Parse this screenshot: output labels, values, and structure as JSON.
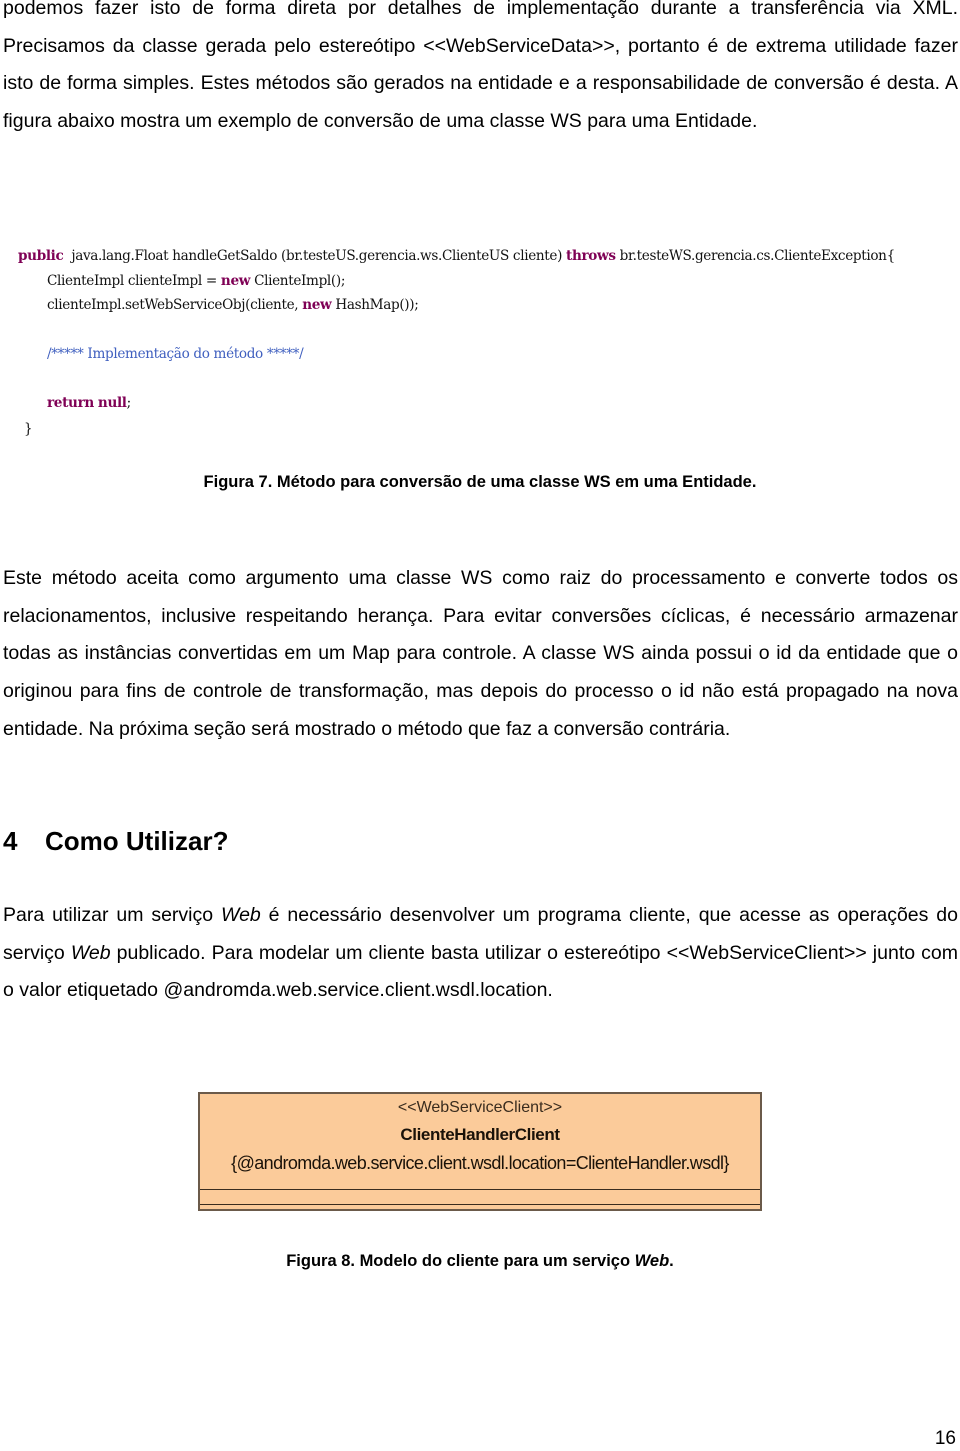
{
  "paragraphs": {
    "p1": "podemos fazer isto de forma direta por detalhes de implementação durante a transferência via XML. Precisamos da classe gerada pelo estereótipo <<WebServiceData>>, portanto é de extrema utilidade fazer isto de forma simples. Estes métodos são gerados na entidade e a responsabilidade de conversão é desta. A figura abaixo mostra um exemplo de conversão de uma classe WS para uma Entidade.",
    "p2": "Este método aceita como argumento uma classe WS como raiz do processamento e converte todos os relacionamentos, inclusive respeitando herança. Para evitar conversões cíclicas, é necessário armazenar todas as instâncias convertidas em um Map para controle. A classe WS ainda possui o id da entidade que o originou para fins de controle de transformação, mas depois do processo o id não está propagado na nova entidade. Na próxima seção será mostrado o método que faz a conversão contrária.",
    "p3_before_web1": "Para utilizar um serviço ",
    "p3_web1": "Web",
    "p3_mid": " é necessário desenvolver um programa cliente, que acesse as operações do serviço ",
    "p3_web2": "Web",
    "p3_after": " publicado. Para modelar um cliente basta utilizar o estereótipo <<WebServiceClient>> junto com o valor etiquetado @andromda.web.service.client.wsdl.location."
  },
  "code_figure": {
    "line1": {
      "kw_public": "public",
      "sig": "  java.lang.Float handleGetSaldo (br.testeUS.gerencia.ws.ClienteUS cliente) ",
      "kw_throws": "throws",
      "exc": " br.testeWS.gerencia.cs.ClienteException{"
    },
    "line2": {
      "a": "ClienteImpl clienteImpl = ",
      "kw": "new",
      "b": " ClienteImpl();"
    },
    "line3": {
      "a": "clienteImpl.setWebServiceObj(cliente, ",
      "kw": "new",
      "b": " HashMap());"
    },
    "line4": "/***** Implementação do método *****/",
    "line5": {
      "kw_return": "return",
      "kw_null": "null",
      "semi": ";"
    },
    "line6": "}"
  },
  "captions": {
    "fig7": "Figura 7. Método para conversão de uma classe WS em uma Entidade.",
    "fig8_prefix": "Figura 8. Modelo do cliente para um serviço ",
    "fig8_italic": "Web",
    "fig8_suffix": "."
  },
  "section": {
    "number": "4",
    "title": "Como Utilizar?"
  },
  "uml_class": {
    "stereotype": "<<WebServiceClient>>",
    "name": "ClienteHandlerClient",
    "tagged_value": "{@andromda.web.service.client.wsdl.location=ClienteHandler.wsdl}"
  },
  "page_number": "16"
}
